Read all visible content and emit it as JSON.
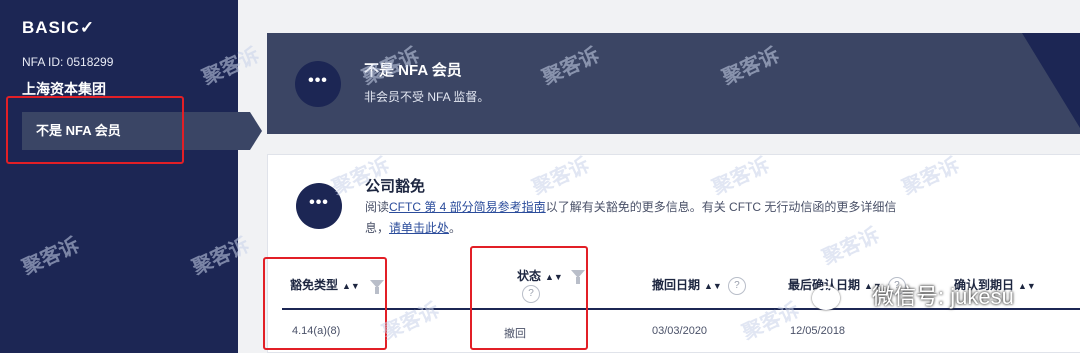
{
  "sidebar": {
    "brand": "BASIC",
    "nfa_id": "NFA ID:  0518299",
    "firm_name": "上海资本集团",
    "status_item": "不是 NFA 会员"
  },
  "banner": {
    "title": "不是 NFA 会员",
    "subtitle": "非会员不受 NFA 监督。",
    "icon": "•••"
  },
  "exemptions": {
    "icon": "•••",
    "title": "公司豁免",
    "desc_prefix": "阅读",
    "desc_link": "CFTC 第 4 部分简易参考指南",
    "desc_mid": "以了解有关豁免的更多信息。有关 CFTC 无行动信函的更多详细信息，",
    "desc_link2": "请单击此处",
    "desc_suffix": "。",
    "columns": [
      {
        "label": "豁免类型"
      },
      {
        "label": "状态"
      },
      {
        "label": "撤回日期"
      },
      {
        "label": "最后确认日期"
      },
      {
        "label": "确认到期日"
      }
    ],
    "row": {
      "type": "4.14(a)(8)",
      "status": "撤回",
      "withdrawn": "03/03/2020",
      "last_confirmed": "12/05/2018",
      "expires": ""
    }
  },
  "watermark": "聚客诉",
  "wechat": "微信号: jukesu",
  "help_glyph": "?",
  "colors": {
    "sidebar": "#1c2654",
    "banner": "#3b4564",
    "highlight_box": "#e21f26",
    "link": "#2b4c9b"
  }
}
